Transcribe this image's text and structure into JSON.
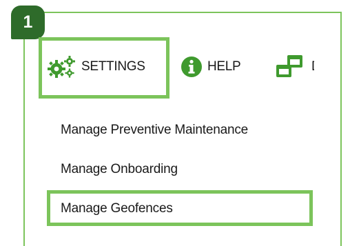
{
  "step": {
    "number": "1"
  },
  "toolbar": {
    "settings_label": "SETTINGS",
    "help_label": "HELP",
    "dashboard_label_partial": "D"
  },
  "menu": {
    "items": [
      {
        "label": "Manage Preventive Maintenance"
      },
      {
        "label": "Manage Onboarding"
      },
      {
        "label": "Manage Geofences"
      }
    ]
  },
  "icons": {
    "settings": "gears-icon",
    "help": "info-circle-icon",
    "dashboard": "windows-icon"
  },
  "colors": {
    "highlight": "#7cc45b",
    "badge": "#2e6b2a",
    "icon_green": "#3f9a2e",
    "text": "#1a1a1a"
  }
}
